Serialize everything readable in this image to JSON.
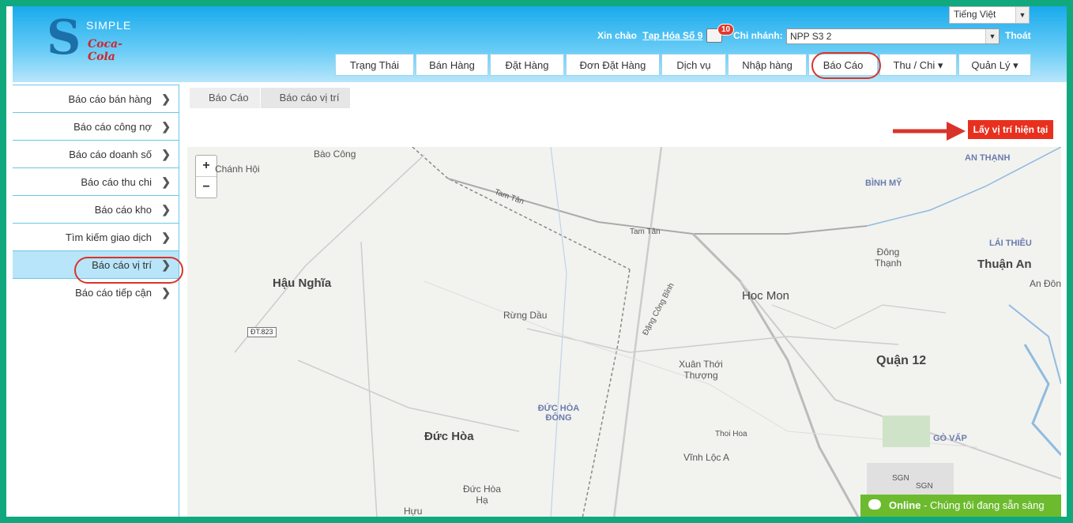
{
  "header": {
    "logo_text": "SIMPLE",
    "logo_brand": "Coca-Cola",
    "language": "Tiếng Việt",
    "greeting": "Xin chào",
    "user": "Tạp Hóa Số 9",
    "notification_count": "10",
    "branch_label": "Chi nhánh:",
    "branch_value": "NPP S3 2",
    "logout": "Thoát"
  },
  "nav": {
    "items": [
      "Trạng Thái",
      "Bán Hàng",
      "Đặt Hàng",
      "Đơn Đặt Hàng",
      "Dịch vụ",
      "Nhập hàng",
      "Báo Cáo",
      "Thu / Chi ▾",
      "Quản Lý ▾"
    ]
  },
  "sidebar": {
    "items": [
      "Báo cáo bán hàng",
      "Báo cáo công nợ",
      "Báo cáo doanh số",
      "Báo cáo thu chi",
      "Báo cáo kho",
      "Tìm kiếm giao dịch",
      "Báo cáo vị trí",
      "Báo cáo tiếp cận"
    ]
  },
  "breadcrumb": [
    "Báo Cáo",
    "Báo cáo vị trí"
  ],
  "location_button": "Lấy vị trí hiện tại",
  "map": {
    "zoom_in": "+",
    "zoom_out": "−",
    "labels": {
      "bao_cong": "Bào Công",
      "chanh_hoi": "Chánh Hội",
      "hau_nghia": "Hậu Nghĩa",
      "rung_dau": "Rừng Dầu",
      "duc_hoa": "Đức Hòa",
      "duc_hoa_dong": "ĐỨC HÒA ĐÔNG",
      "duc_hoa_ha": "Đức Hòa Hạ",
      "huu": "Hựu",
      "hoc_mon": "Hoc Mon",
      "quan12": "Quận 12",
      "thuan_an": "Thuận An",
      "xuan_thoi": "Xuân Thới Thượng",
      "vinh_loc": "Vĩnh Lộc A",
      "an_thanh": "AN THẠNH",
      "binh_my": "BÌNH MỸ",
      "dong_thanh": "Đông Thạnh",
      "lai_thieu": "LÁI THIÊU",
      "an_don": "An Đôn",
      "go_vap": "GÒ VẤP",
      "sgn1": "SGN",
      "sgn2": "SGN",
      "tam_tan1": "Tam Tân",
      "tam_tan2": "Tam Tân",
      "dang_cong_binh": "Đặng Công Bỉnh",
      "thoi_hoa": "Thoi Hoa",
      "dt823": "ĐT.823"
    }
  },
  "chat": {
    "status": "Online",
    "message": " - Chúng tôi đang sẵn sàng"
  }
}
